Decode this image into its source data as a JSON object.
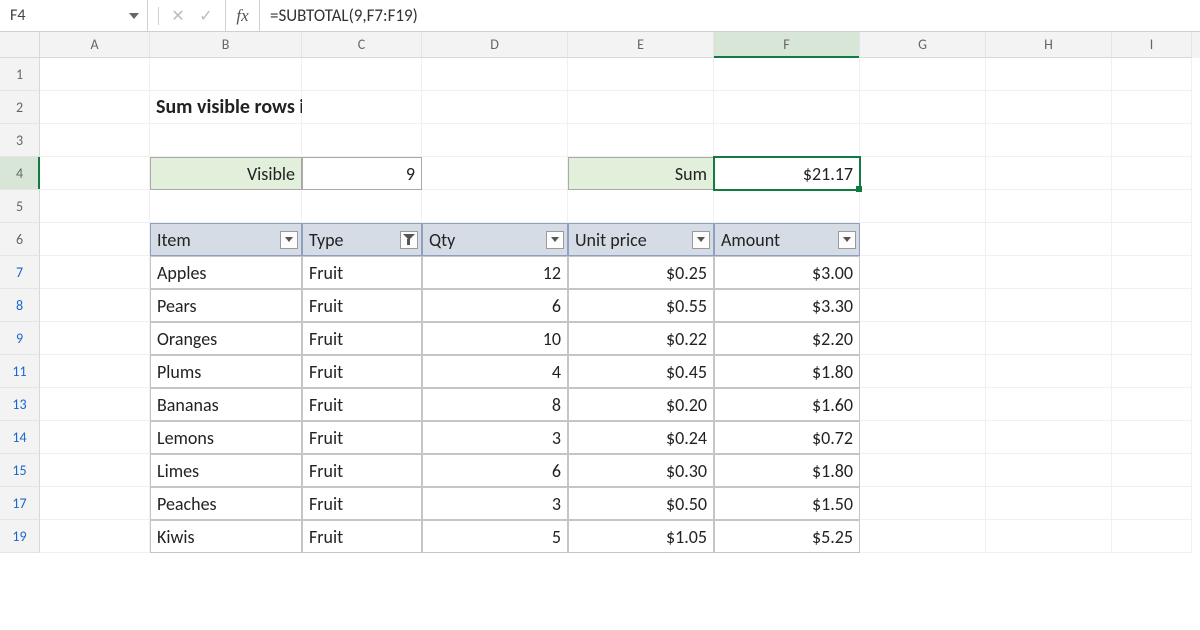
{
  "namebox": "F4",
  "fx_label": "fx",
  "formula": "=SUBTOTAL(9,F7:F19)",
  "col_heads": [
    "A",
    "B",
    "C",
    "D",
    "E",
    "F",
    "G",
    "H",
    "I"
  ],
  "selected_col": "F",
  "selected_row": "4",
  "row_heads": [
    "1",
    "2",
    "3",
    "4",
    "5",
    "6",
    "7",
    "8",
    "9",
    "11",
    "13",
    "14",
    "15",
    "17",
    "19"
  ],
  "title": "Sum visible rows in a filtered list",
  "visible_label": "Visible",
  "visible_value": "9",
  "sum_label": "Sum",
  "sum_value": "$21.17",
  "table": {
    "headers": [
      "Item",
      "Type",
      "Qty",
      "Unit price",
      "Amount"
    ],
    "filtered_col_index": 1,
    "rows": [
      {
        "item": "Apples",
        "type": "Fruit",
        "qty": "12",
        "unit": "$0.25",
        "amount": "$3.00"
      },
      {
        "item": "Pears",
        "type": "Fruit",
        "qty": "6",
        "unit": "$0.55",
        "amount": "$3.30"
      },
      {
        "item": "Oranges",
        "type": "Fruit",
        "qty": "10",
        "unit": "$0.22",
        "amount": "$2.20"
      },
      {
        "item": "Plums",
        "type": "Fruit",
        "qty": "4",
        "unit": "$0.45",
        "amount": "$1.80"
      },
      {
        "item": "Bananas",
        "type": "Fruit",
        "qty": "8",
        "unit": "$0.20",
        "amount": "$1.60"
      },
      {
        "item": "Lemons",
        "type": "Fruit",
        "qty": "3",
        "unit": "$0.24",
        "amount": "$0.72"
      },
      {
        "item": "Limes",
        "type": "Fruit",
        "qty": "6",
        "unit": "$0.30",
        "amount": "$1.80"
      },
      {
        "item": "Peaches",
        "type": "Fruit",
        "qty": "3",
        "unit": "$0.50",
        "amount": "$1.50"
      },
      {
        "item": "Kiwis",
        "type": "Fruit",
        "qty": "5",
        "unit": "$1.05",
        "amount": "$5.25"
      }
    ]
  }
}
